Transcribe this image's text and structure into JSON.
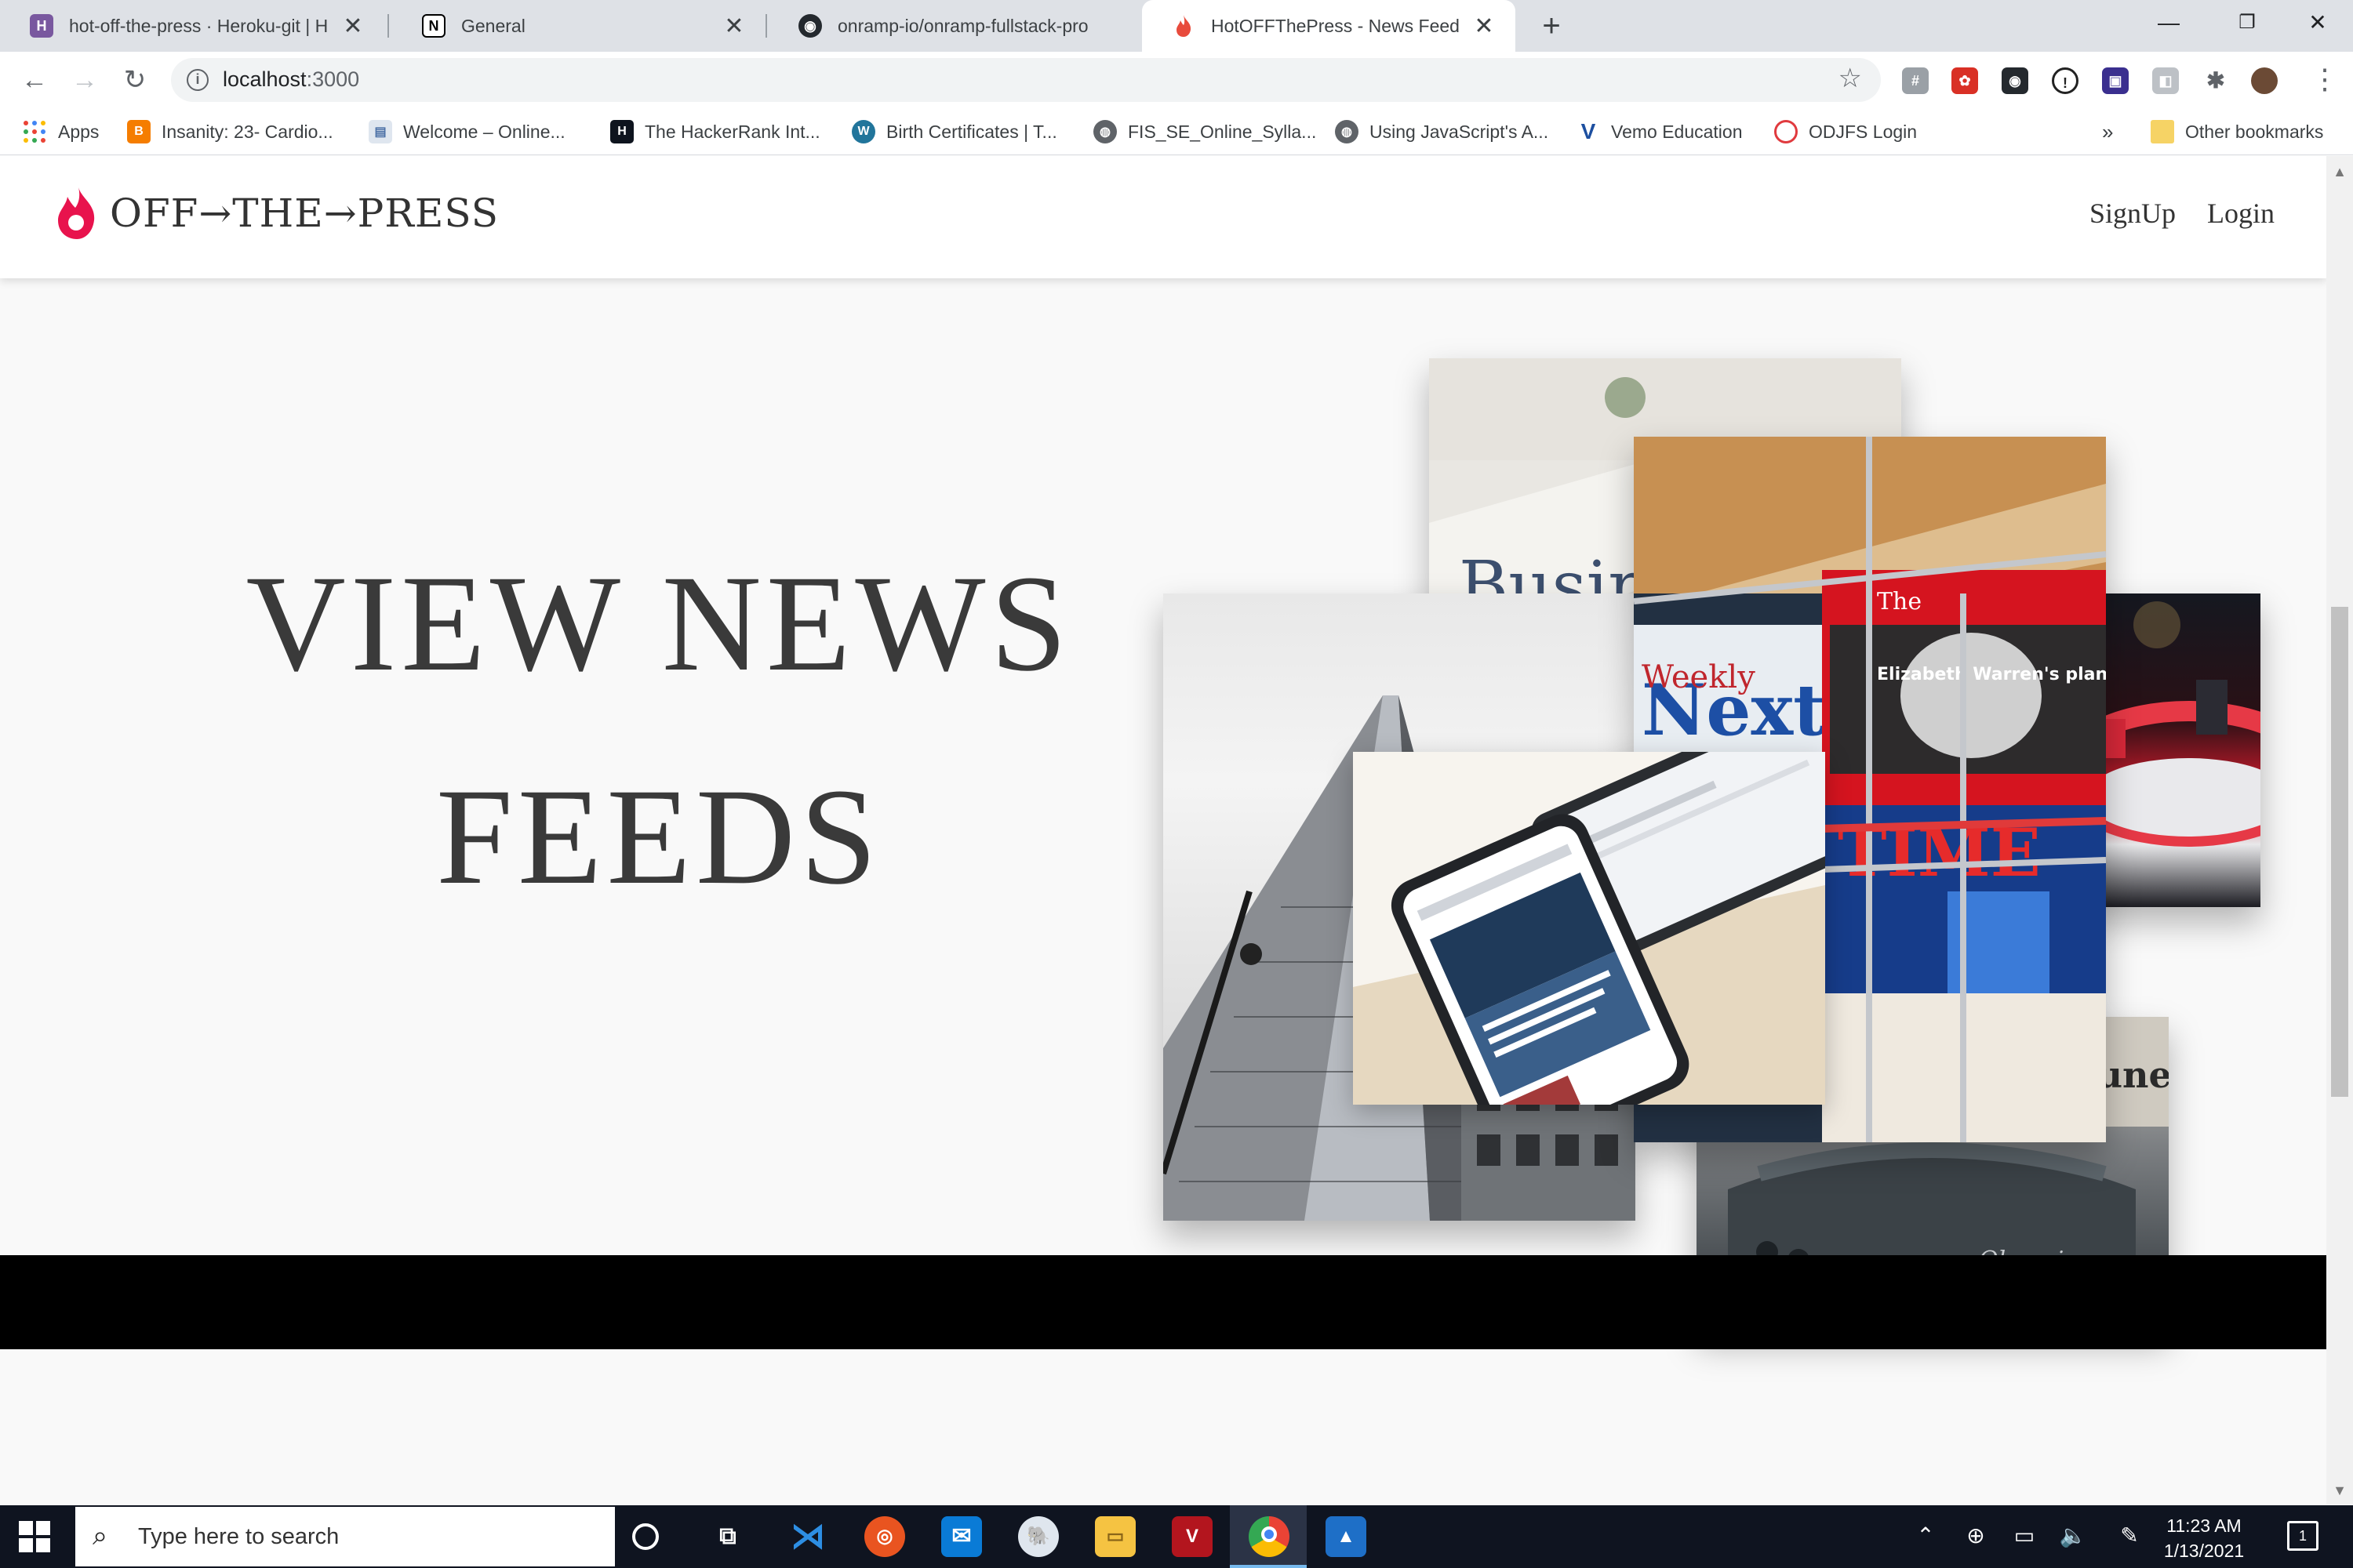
{
  "browser": {
    "tabs": [
      {
        "title": "hot-off-the-press · Heroku-git | H",
        "favicon": "heroku-icon"
      },
      {
        "title": "General",
        "favicon": "notion-icon"
      },
      {
        "title": "onramp-io/onramp-fullstack-pro",
        "favicon": "github-icon"
      },
      {
        "title": "HotOFFThePress - News Feed",
        "favicon": "flame-icon",
        "active": true
      }
    ],
    "url_host": "localhost",
    "url_port": ":3000",
    "bookmarks": [
      {
        "label": "Apps"
      },
      {
        "label": "Insanity: 23- Cardio..."
      },
      {
        "label": "Welcome – Online..."
      },
      {
        "label": "The HackerRank Int..."
      },
      {
        "label": "Birth Certificates | T..."
      },
      {
        "label": "FIS_SE_Online_Sylla..."
      },
      {
        "label": "Using JavaScript's A..."
      },
      {
        "label": "Vemo Education"
      },
      {
        "label": "ODJFS Login"
      }
    ],
    "bookmarks_overflow": "»",
    "other_bookmarks": "Other bookmarks"
  },
  "site": {
    "brand": "OFF→THE→PRESS",
    "nav": {
      "signup": "SignUp",
      "login": "Login"
    },
    "hero": {
      "line1": "VIEW NEWS",
      "line2": "FEEDS"
    },
    "accent_color": "#e8134d"
  },
  "taskbar": {
    "search_placeholder": "Type here to search",
    "time": "11:23 AM",
    "date": "1/13/2021",
    "notification_count": "1"
  }
}
